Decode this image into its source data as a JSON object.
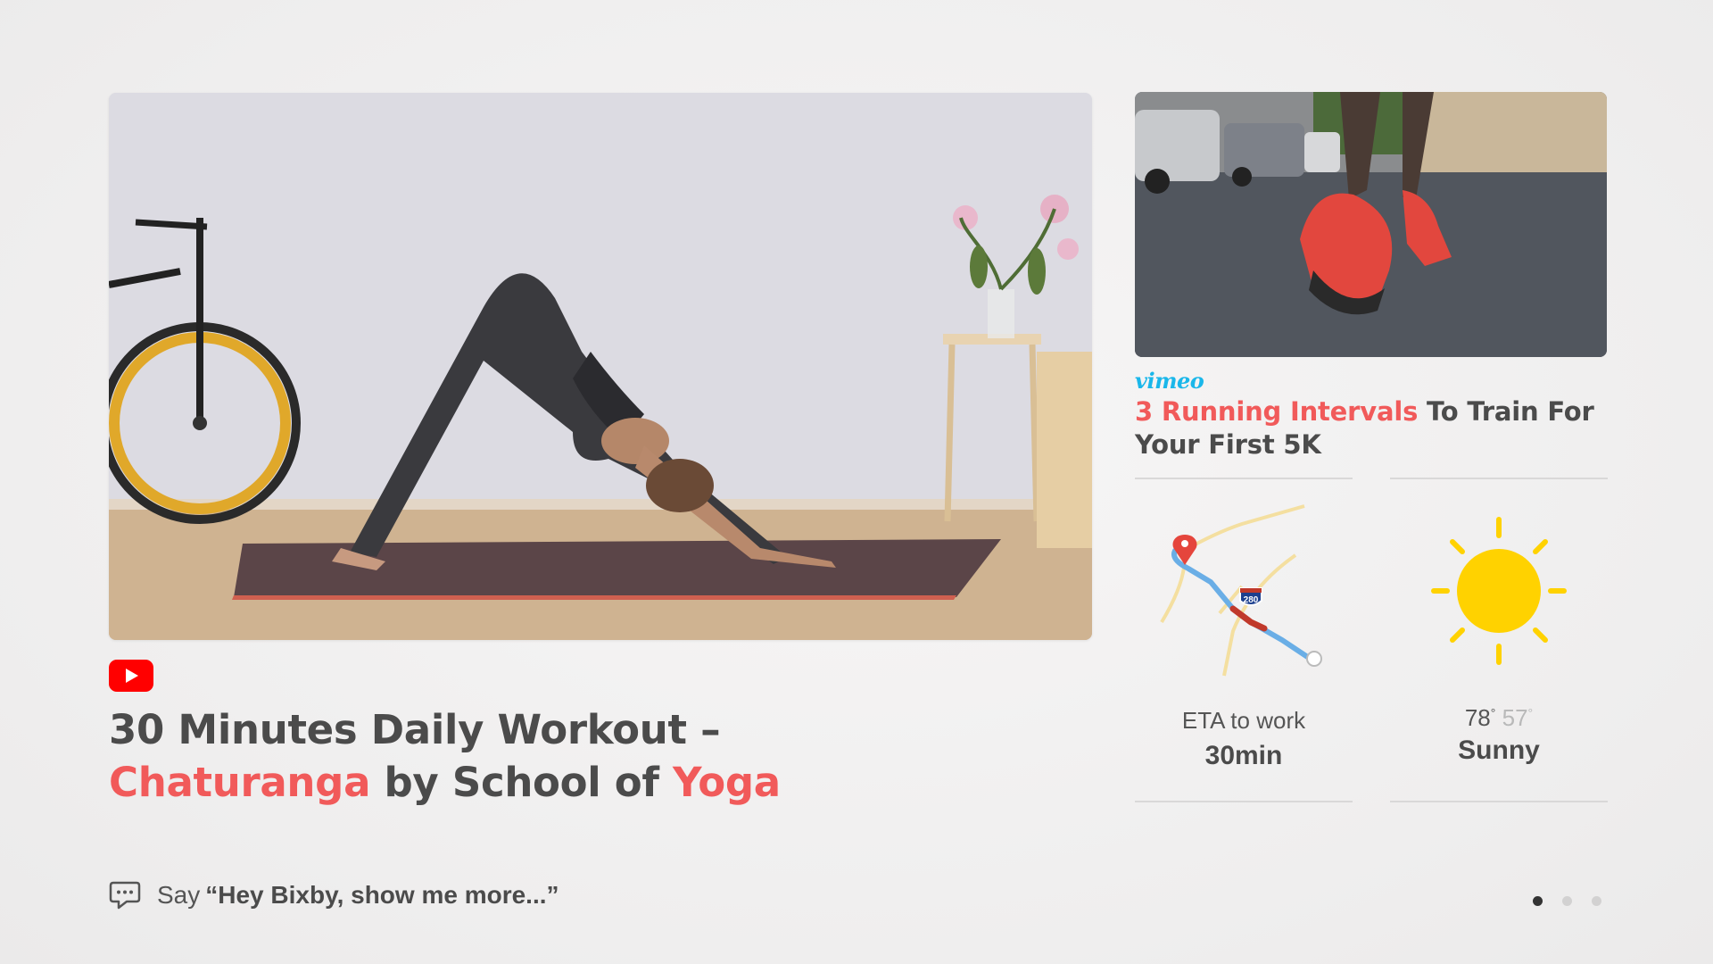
{
  "main_card": {
    "source_icon": "youtube-icon",
    "title_part1": "30 Minutes Daily Workout –",
    "title_accent1": "Chaturanga",
    "title_part2": " by School of ",
    "title_accent2": "Yoga"
  },
  "side_card": {
    "source_logo": "vimeo",
    "title_accent": "3 Running Intervals",
    "title_rest": " To Train For Your First 5K"
  },
  "eta_widget": {
    "label": "ETA to work",
    "value": "30min",
    "highway_shield": "280"
  },
  "weather_widget": {
    "icon": "sun-icon",
    "high": "78",
    "low": "57",
    "degree": "°",
    "condition": "Sunny"
  },
  "footer": {
    "hint_prefix": "Say",
    "hint_phrase": "“Hey Bixby, show me more...”"
  },
  "pager": {
    "pages": 3,
    "active": 1
  },
  "colors": {
    "accent": "#f15a5a",
    "vimeo": "#1ab7ea",
    "youtube": "#ff0000",
    "sun": "#ffd200",
    "route": "#6aaee6"
  }
}
